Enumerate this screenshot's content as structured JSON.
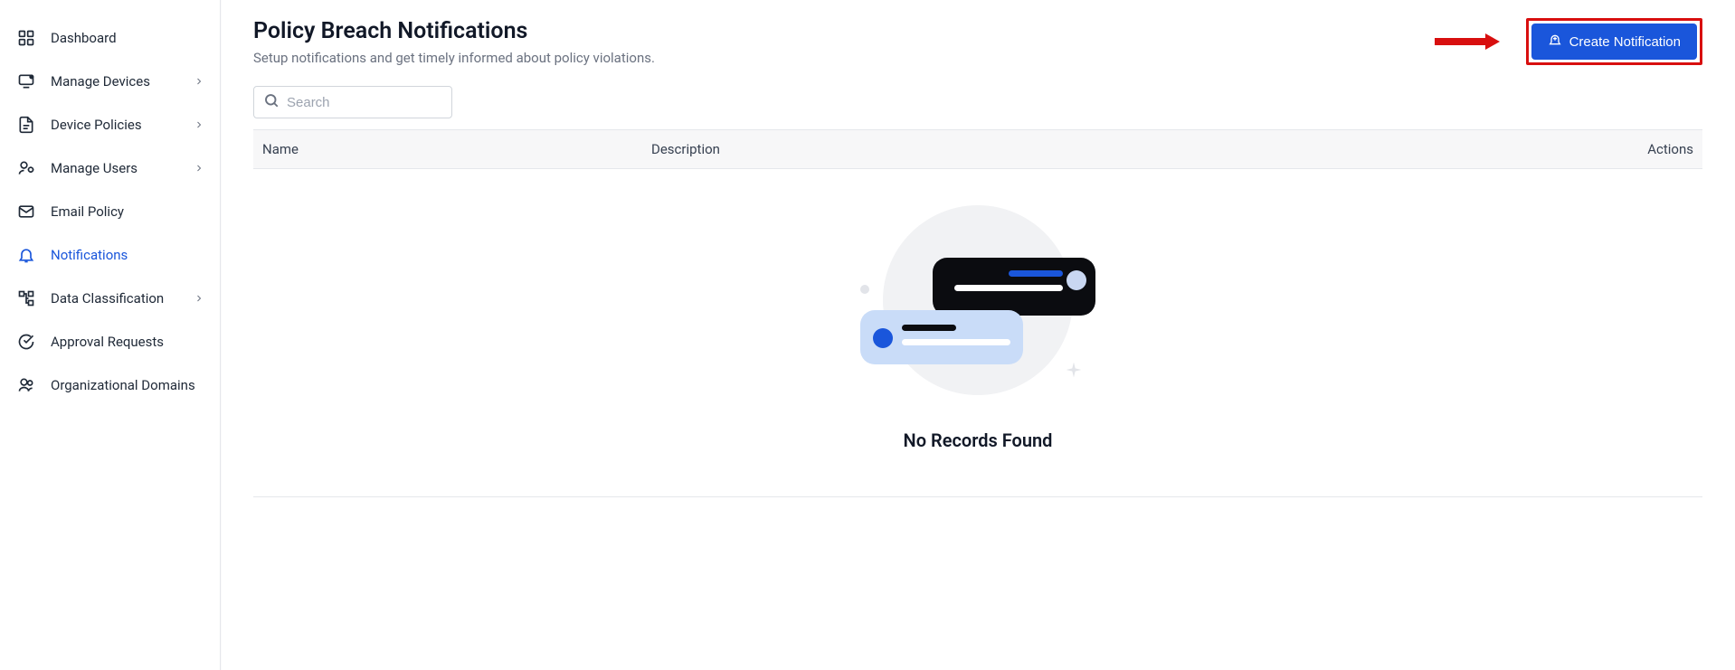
{
  "sidebar": {
    "items": [
      {
        "label": "Dashboard",
        "expandable": false,
        "active": false
      },
      {
        "label": "Manage Devices",
        "expandable": true,
        "active": false
      },
      {
        "label": "Device Policies",
        "expandable": true,
        "active": false
      },
      {
        "label": "Manage Users",
        "expandable": true,
        "active": false
      },
      {
        "label": "Email Policy",
        "expandable": false,
        "active": false
      },
      {
        "label": "Notifications",
        "expandable": false,
        "active": true
      },
      {
        "label": "Data Classification",
        "expandable": true,
        "active": false
      },
      {
        "label": "Approval Requests",
        "expandable": false,
        "active": false
      },
      {
        "label": "Organizational Domains",
        "expandable": false,
        "active": false
      }
    ]
  },
  "header": {
    "title": "Policy Breach Notifications",
    "subtitle": "Setup notifications and get timely informed about policy violations.",
    "create_label": "Create Notification"
  },
  "search": {
    "placeholder": "Search",
    "value": ""
  },
  "table": {
    "columns": {
      "name": "Name",
      "description": "Description",
      "actions": "Actions"
    },
    "rows": []
  },
  "empty_state": {
    "message": "No Records Found"
  },
  "colors": {
    "accent": "#1a56db",
    "highlight": "#d80f0f"
  }
}
